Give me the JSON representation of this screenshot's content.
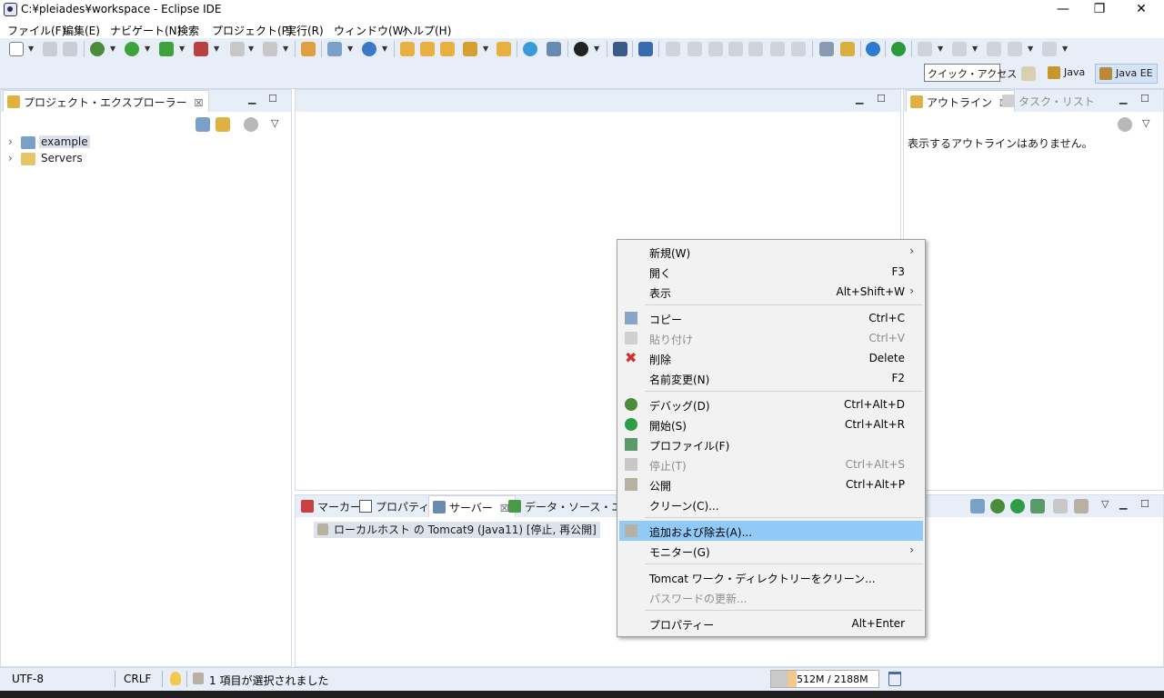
{
  "window": {
    "title": "C:¥pleiades¥workspace - Eclipse IDE",
    "minimize_glyph": "—",
    "restore_glyph": "❐",
    "close_glyph": "✕"
  },
  "menu": [
    "ファイル(F)",
    "編集(E)",
    "ナビゲート(N)",
    "検索",
    "プロジェクト(P)",
    "実行(R)",
    "ウィンドウ(W)",
    "ヘルプ(H)"
  ],
  "toolbar": {
    "quick_access": "クイック・アクセス",
    "perspectives": [
      "Java",
      "Java EE"
    ]
  },
  "project_explorer": {
    "tab_label": "プロジェクト・エクスプローラー",
    "close_glyph": "☒",
    "tree": [
      {
        "label": "example",
        "selected": true
      },
      {
        "label": "Servers",
        "selected": false
      }
    ],
    "expand_glyph": "›"
  },
  "outline": {
    "tab_label": "アウトライン",
    "task_tab_label": "タスク・リスト",
    "empty_message": "表示するアウトラインはありません。"
  },
  "bottom_panel": {
    "tabs": [
      "マーカー",
      "プロパティー",
      "サーバー",
      "データ・ソース・エクスプ"
    ],
    "server_entry": "ローカルホスト の Tomcat9 (Java11)  [停止, 再公開]"
  },
  "context_menu": {
    "submenu_glyph": "›",
    "items": [
      {
        "label": "新規(W)",
        "accel": "",
        "submenu": true
      },
      {
        "label": "開く",
        "accel": "F3"
      },
      {
        "label": "表示",
        "accel": "Alt+Shift+W",
        "submenu": true
      },
      {
        "label": "コピー",
        "accel": "Ctrl+C"
      },
      {
        "label": "貼り付け",
        "accel": "Ctrl+V",
        "disabled": true
      },
      {
        "label": "削除",
        "accel": "Delete"
      },
      {
        "label": "名前変更(N)",
        "accel": "F2"
      },
      {
        "label": "デバッグ(D)",
        "accel": "Ctrl+Alt+D"
      },
      {
        "label": "開始(S)",
        "accel": "Ctrl+Alt+R"
      },
      {
        "label": "プロファイル(F)",
        "accel": ""
      },
      {
        "label": "停止(T)",
        "accel": "Ctrl+Alt+S",
        "disabled": true
      },
      {
        "label": "公開",
        "accel": "Ctrl+Alt+P"
      },
      {
        "label": "クリーン(C)...",
        "accel": ""
      },
      {
        "label": "追加および除去(A)...",
        "accel": "",
        "highlighted": true
      },
      {
        "label": "モニター(G)",
        "accel": "",
        "submenu": true
      },
      {
        "label": "Tomcat ワーク・ディレクトリーをクリーン...",
        "accel": ""
      },
      {
        "label": "パスワードの更新...",
        "accel": "",
        "disabled": true
      },
      {
        "label": "プロパティー",
        "accel": "Alt+Enter"
      }
    ]
  },
  "status": {
    "encoding": "UTF-8",
    "line_ending": "CRLF",
    "selection": "1 項目が選択されました",
    "heap": "512M / 2188M",
    "heap_used_fraction": 0.234
  },
  "colors": {
    "accent": "#91c9f7",
    "toolbar_bg": "#e8eef8",
    "heap_fill": "#f5c78e"
  }
}
